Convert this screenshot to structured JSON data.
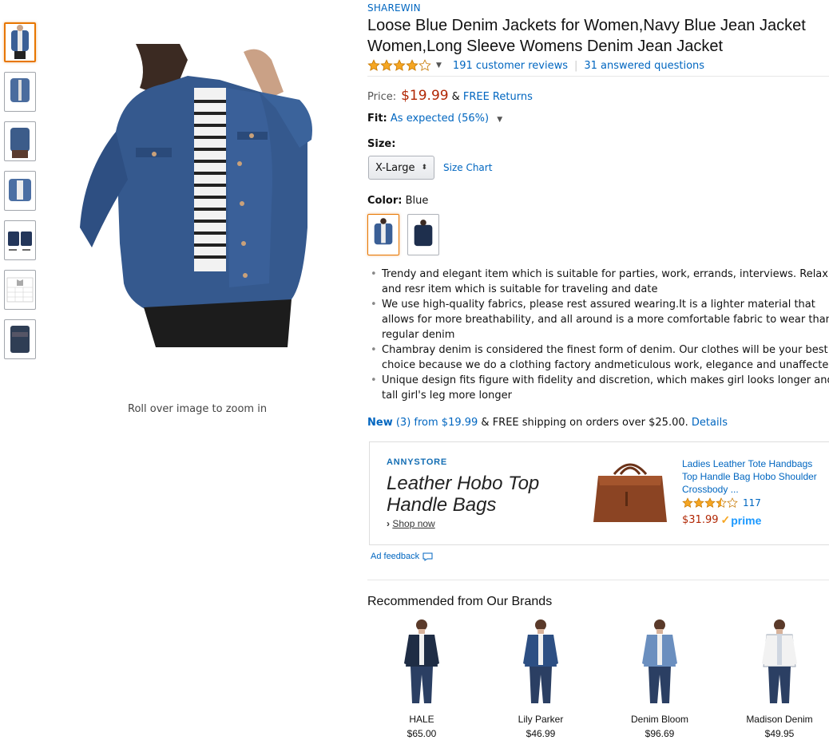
{
  "thumbnails": [
    {
      "name": "thumb-front",
      "active": true
    },
    {
      "name": "thumb-side",
      "active": false
    },
    {
      "name": "thumb-back",
      "active": false
    },
    {
      "name": "thumb-detail",
      "active": false
    },
    {
      "name": "thumb-flat",
      "active": false
    },
    {
      "name": "thumb-size-chart",
      "active": false
    },
    {
      "name": "thumb-folded",
      "active": false
    }
  ],
  "zoom_hint": "Roll over image to zoom in",
  "product": {
    "brand": "SHAREWIN",
    "title_line1": "Loose Blue Denim Jackets for Women,Navy Blue Jean Jacket",
    "title_line2": "Women,Long Sleeve Womens Denim Jean Jacket",
    "rating_stars": 4.0,
    "reviews": "191 customer reviews",
    "questions": "31 answered questions",
    "separator": "|",
    "price_label": "Price:",
    "price": "$19.99",
    "free_returns_amp": "&",
    "free_returns": "FREE Returns",
    "fit_label": "Fit:",
    "fit_value": "As expected (56%)",
    "size_label": "Size:",
    "size_selected": "X-Large",
    "size_chart": "Size Chart",
    "color_label": "Color:",
    "color_value": "Blue",
    "bullets": [
      "Trendy and elegant item which is suitable for parties, work, errands, interviews. Relax and resr item which is suitable for traveling and date",
      "We use high-quality fabrics, please rest assured wearing.It is a lighter material that allows for more breathability, and all around is a more comfortable fabric to wear than regular denim",
      "Chambray denim is considered the finest form of denim. Our clothes will be your best choice because we do a clothing factory andmeticulous work, elegance and unaffected",
      "Unique design fits figure with fidelity and discretion, which makes girl looks longer and tall girl's leg more longer"
    ],
    "offers_new": "New",
    "offers_count_from": "(3) from $19.99",
    "offers_shipping": "& FREE shipping on orders over $25.00.",
    "offers_details": "Details"
  },
  "ad": {
    "brand": "ANNYSTORE",
    "headline": "Leather Hobo Top Handle Bags",
    "shop_now": "Shop now",
    "shop_arrow": "›",
    "product_title": "Ladies Leather Tote Handbags Top Handle Bag Hobo Shoulder Crossbody ...",
    "rating_stars": 3.5,
    "rating_count": "117",
    "price": "$31.99",
    "prime": "prime",
    "feedback": "Ad feedback"
  },
  "recommended": {
    "title": "Recommended from Our Brands",
    "items": [
      {
        "name": "HALE",
        "price": "$65.00",
        "jacket": "#1f2d45"
      },
      {
        "name": "Lily Parker",
        "price": "$46.99",
        "jacket": "#2d4f83"
      },
      {
        "name": "Denim Bloom",
        "price": "$96.69",
        "jacket": "#6b8fbf"
      },
      {
        "name": "Madison Denim",
        "price": "$49.95",
        "jacket": "#f2f2f2"
      }
    ]
  },
  "colors": {
    "link": "#0066c0",
    "price": "#b12704",
    "star": "#f5a623",
    "active_border": "#e77600"
  }
}
